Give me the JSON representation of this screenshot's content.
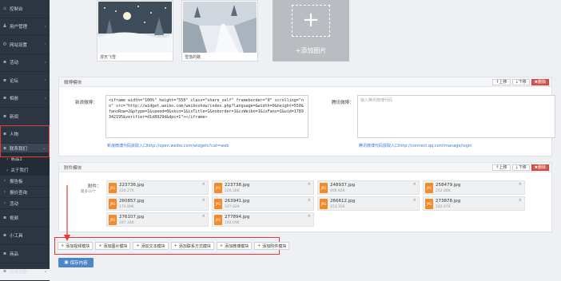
{
  "sidebar": {
    "items": [
      {
        "icon": "dashboard-icon",
        "label": "控制台"
      },
      {
        "icon": "users-icon",
        "label": "用户管理"
      },
      {
        "icon": "settings-icon",
        "label": "网站设置"
      },
      {
        "icon": "activity-icon",
        "label": "活动"
      },
      {
        "icon": "forum-icon",
        "label": "论坛"
      },
      {
        "icon": "album-icon",
        "label": "相册"
      },
      {
        "icon": "news-icon",
        "label": "新闻"
      },
      {
        "icon": "person-icon",
        "label": "人物"
      },
      {
        "icon": "contact-icon",
        "label": "联系我们"
      }
    ],
    "subitems": [
      {
        "label": "商品2"
      },
      {
        "label": "关于我们"
      }
    ],
    "items2": [
      {
        "icon": "report-icon",
        "label": "报告板"
      },
      {
        "icon": "query-icon",
        "label": "报价查询"
      },
      {
        "icon": "event-icon",
        "label": "活动"
      },
      {
        "icon": "video-icon",
        "label": "视频"
      },
      {
        "icon": "tools-icon",
        "label": "小工具"
      },
      {
        "icon": "product-icon",
        "label": "商品"
      },
      {
        "icon": "advanced-icon",
        "label": "高级功能"
      }
    ]
  },
  "gallery": {
    "images": [
      {
        "caption": "漫天飞雪"
      },
      {
        "caption": "雪落的路"
      }
    ],
    "add_label": "+添加图片"
  },
  "weibo_panel": {
    "title": "微博模块",
    "up_label": "上移",
    "down_label": "下移",
    "delete_label": "删除",
    "sina_label": "新浪微博：",
    "sina_code": "<iframe width=\"100%\" height=\"550\" class=\"share_self\" frameborder=\"0\" scrolling=\"no\" src=\"http://widget.weibo.com/weiboshow/index.php?language=&width=0&height=550&fansRow=2&ptype=1&speed=0&skin=1&isTitle=1&noborder=1&isWeibo=1&isFans=1&uid=1789342195&verifier=d1d8929d&dpc=1\"></iframe>",
    "sina_link": "新浪微博代码获取入口http://open.weibo.com/widgets?cat=web",
    "tencent_label": "腾讯微博：",
    "tencent_placeholder": "输入腾讯微博代码",
    "tencent_link": "腾讯微博代码获取入口http://connect.qq.com/manage/login"
  },
  "attach_panel": {
    "title": "附件模块",
    "up_label": "上移",
    "down_label": "下移",
    "delete_label": "删除",
    "field_label": "附件：",
    "field_hint": "最多10个",
    "files": [
      {
        "name": "223736.jpg",
        "size": "226.27K"
      },
      {
        "name": "223738.jpg",
        "size": "226.36K"
      },
      {
        "name": "248937.jpg",
        "size": "406.82K"
      },
      {
        "name": "258479.jpg",
        "size": "252.88K"
      },
      {
        "name": "260857.jpg",
        "size": "174.89K"
      },
      {
        "name": "263941.jpg",
        "size": "507.02K"
      },
      {
        "name": "266612.jpg",
        "size": "153.35K"
      },
      {
        "name": "273878.jpg",
        "size": "182.07K"
      },
      {
        "name": "276107.jpg",
        "size": "287.34K"
      },
      {
        "name": "277894.jpg",
        "size": "192.09K"
      }
    ]
  },
  "toolbar": {
    "buttons": [
      {
        "label": "添加视频模块"
      },
      {
        "label": "添加图片模块"
      },
      {
        "label": "添加文本模块"
      },
      {
        "label": "添加联系方式模块"
      },
      {
        "label": "添加微博模块"
      },
      {
        "label": "添加附件模块"
      }
    ]
  },
  "save_label": "保存内容",
  "colors": {
    "sidebar_bg": "#2c3542",
    "highlight": "#e53935",
    "primary": "#4a86c8",
    "file_icon": "#f28a2b"
  }
}
